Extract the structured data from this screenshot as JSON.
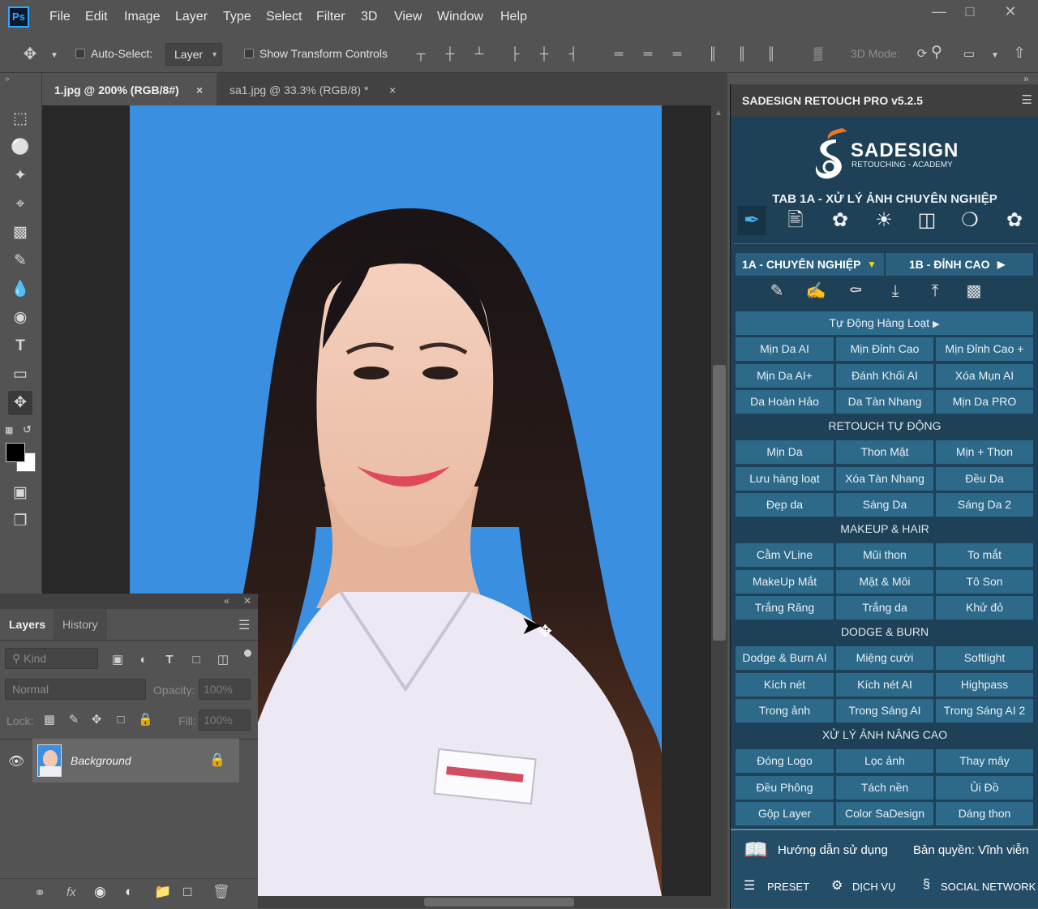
{
  "app": {
    "logo": "Ps"
  },
  "menu": {
    "items": [
      "File",
      "Edit",
      "Image",
      "Layer",
      "Type",
      "Select",
      "Filter",
      "3D",
      "View",
      "Window",
      "Help"
    ]
  },
  "options": {
    "auto_select": "Auto-Select:",
    "layer_dd": "Layer",
    "show_transform": "Show Transform Controls",
    "mode3d": "3D Mode:"
  },
  "tabs": [
    {
      "label": "1.jpg @ 200% (RGB/8#)",
      "close": "×"
    },
    {
      "label": "sa1.jpg @ 33.3% (RGB/8) *",
      "close": "×"
    }
  ],
  "layers_panel": {
    "tabs": [
      "Layers",
      "History"
    ],
    "kind": "Kind",
    "blend": "Normal",
    "opacity_label": "Opacity:",
    "opacity_value": "100%",
    "lock_label": "Lock:",
    "fill_label": "Fill:",
    "fill_value": "100%",
    "layer_name": "Background"
  },
  "plugin": {
    "header": "SADESIGN RETOUCH PRO v5.2.5",
    "brand": "SADESIGN",
    "brand_sub": "RETOUCHING - ACADEMY",
    "tab_title": "TAB 1A - XỬ LÝ ẢNH CHUYÊN NGHIỆP",
    "subtab_a": "1A - CHUYÊN NGHIỆP",
    "subtab_b": "1B - ĐỈNH CAO",
    "auto_batch": "Tự Động Hàng Loạt",
    "grid1": [
      "Mịn Da AI",
      "Mịn Đỉnh Cao",
      "Mịn Đỉnh Cao +",
      "Mịn Da AI+",
      "Đánh Khối AI",
      "Xóa Mụn AI",
      "Da Hoàn Hảo",
      "Da Tàn Nhang",
      "Mịn Da PRO"
    ],
    "sec2": "RETOUCH TỰ ĐỘNG",
    "grid2": [
      "Mịn Da",
      "Thon Mặt",
      "Mịn + Thon",
      "Lưu hàng loạt",
      "Xóa Tàn Nhang",
      "Đều Da",
      "Đẹp da",
      "Sáng Da",
      "Sáng Da 2"
    ],
    "sec3": "MAKEUP & HAIR",
    "grid3": [
      "Cằm VLine",
      "Mũi thon",
      "To mắt",
      "MakeUp Mắt",
      "Mặt & Môi",
      "Tô Son",
      "Trắng Răng",
      "Trắng da",
      "Khử đỏ"
    ],
    "sec4": "DODGE & BURN",
    "grid4": [
      "Dodge & Burn AI",
      "Miệng cười",
      "Softlight",
      "Kích nét",
      "Kích nét AI",
      "Highpass",
      "Trong ảnh",
      "Trong Sáng AI",
      "Trong Sáng AI 2"
    ],
    "sec5": "XỬ LÝ ẢNH NÂNG CAO",
    "grid5": [
      "Đóng Logo",
      "Lọc ảnh",
      "Thay mây",
      "Đều Phông",
      "Tách nền",
      "Ủi Đồ",
      "Gộp Layer",
      "Color SaDesign",
      "Dáng thon"
    ],
    "guide": "Hướng dẫn sử dụng",
    "license": "Bản quyền: Vĩnh viễn",
    "preset": "PRESET",
    "service": "DỊCH VỤ",
    "social": "SOCIAL NETWORK"
  }
}
